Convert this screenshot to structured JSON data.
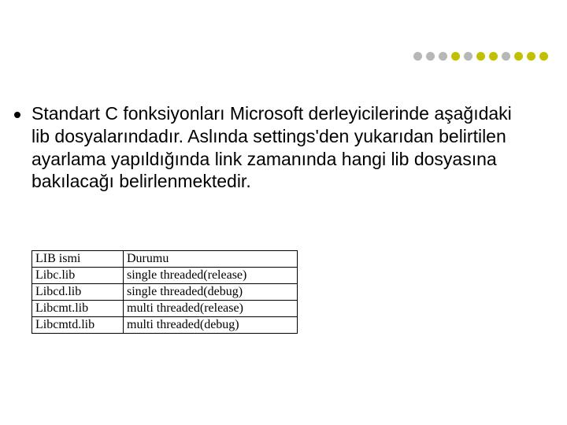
{
  "decor": {
    "dot_colors": [
      "#b7b7b7",
      "#b7b7b7",
      "#b7b7b7",
      "#c0c000",
      "#b7b7b7",
      "#c0c000",
      "#c0c000",
      "#b7b7b7",
      "#c0c000",
      "#c0c000",
      "#c0c000"
    ]
  },
  "body": {
    "text": "Standart C fonksiyonları Microsoft derleyicilerinde aşağıdaki lib dosyalarındadır. Aslında settings'den yukarıdan belirtilen ayarlama yapıldığında link zamanında hangi lib dosyasına bakılacağı belirlenmektedir."
  },
  "table": {
    "header": {
      "c1": "LIB ismi",
      "c2": "Durumu"
    },
    "rows": [
      {
        "c1": "Libc.lib",
        "c2": "single threaded(release)"
      },
      {
        "c1": "Libcd.lib",
        "c2": "single threaded(debug)"
      },
      {
        "c1": "Libcmt.lib",
        "c2": "multi threaded(release)"
      },
      {
        "c1": "Libcmtd.lib",
        "c2": "multi threaded(debug)"
      }
    ]
  }
}
